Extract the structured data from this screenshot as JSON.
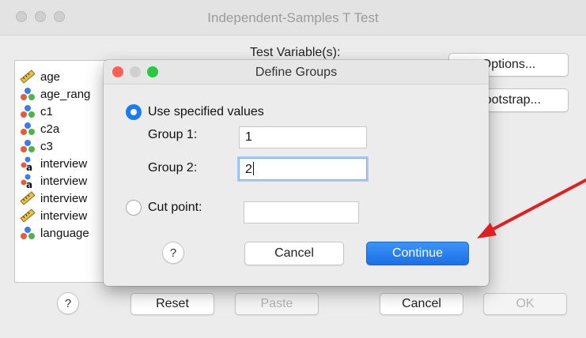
{
  "window": {
    "title": "Independent-Samples T Test"
  },
  "main": {
    "test_variables_label": "Test Variable(s):",
    "options_label": "Options...",
    "bootstrap_label": "Bootstrap...",
    "variables": [
      {
        "label": "age",
        "icon": "scale-ruler-icon"
      },
      {
        "label": "age_rang",
        "icon": "nominal-icon"
      },
      {
        "label": "c1",
        "icon": "nominal-icon"
      },
      {
        "label": "c2a",
        "icon": "nominal-icon"
      },
      {
        "label": "c3",
        "icon": "nominal-icon"
      },
      {
        "label": "interview",
        "icon": "string-nominal-icon"
      },
      {
        "label": "interview",
        "icon": "string-nominal-icon"
      },
      {
        "label": "interview",
        "icon": "scale-ruler-icon"
      },
      {
        "label": "interview",
        "icon": "scale-ruler-icon"
      },
      {
        "label": "language",
        "icon": "nominal-icon"
      }
    ],
    "footer": {
      "help": "?",
      "reset": "Reset",
      "paste": "Paste",
      "cancel": "Cancel",
      "ok": "OK"
    }
  },
  "dialog": {
    "title": "Define Groups",
    "use_specified_label": "Use specified values",
    "group1_label": "Group 1:",
    "group1_value": "1",
    "group2_label": "Group 2:",
    "group2_value": "2",
    "cut_point_label": "Cut point:",
    "cut_point_value": "",
    "help": "?",
    "cancel": "Cancel",
    "continue": "Continue"
  },
  "annotation": {
    "arrow_color": "#e02020"
  },
  "colors": {
    "accent": "#1a7cf2",
    "close": "#fd5f57",
    "minimize": "#fdbc2e",
    "zoom": "#28c840"
  }
}
